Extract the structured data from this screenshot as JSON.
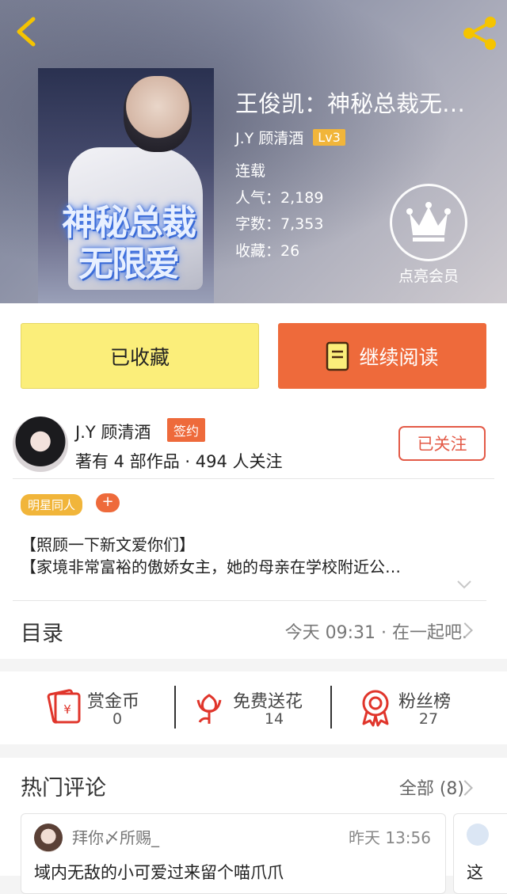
{
  "header": {
    "book_title": "王俊凯：神秘总裁无…",
    "author": "J.Y 顾清酒",
    "level": "Lv3",
    "status": "连载",
    "popularity_label": "人气：",
    "popularity": "2,189",
    "words_label": "字数：",
    "words": "7,353",
    "collect_label": "收藏：",
    "collect": "26",
    "vip_label": "点亮会员",
    "cover_title": "神秘总裁无限爱"
  },
  "actions": {
    "favorited_label": "已收藏",
    "continue_label": "继续阅读"
  },
  "author_card": {
    "name": "J.Y 顾清酒",
    "signed_badge": "签约",
    "stats": "著有 4 部作品 · 494 人关注",
    "follow_label": "已关注",
    "tag": "明星同人",
    "tag_add": "+",
    "intro_line1": "【照顾一下新文爱你们】",
    "intro_line2": "【家境非常富裕的傲娇女主，她的母亲在学校附近公…"
  },
  "toc": {
    "label": "目录",
    "latest": "今天 09:31 · 在一起吧."
  },
  "stats": [
    {
      "label": "赏金币",
      "value": "0",
      "icon": "red-envelope-icon"
    },
    {
      "label": "免费送花",
      "value": "14",
      "icon": "flower-icon"
    },
    {
      "label": "粉丝榜",
      "value": "27",
      "icon": "medal-icon"
    }
  ],
  "comments": {
    "title": "热门评论",
    "all_label": "全部 (8)",
    "items": [
      {
        "user": "拜你〆所赐_",
        "time": "昨天 13:56",
        "text": "域内无敌的小可爱过来留个喵爪爪"
      },
      {
        "user": "",
        "time": "",
        "text": "这"
      }
    ]
  },
  "colors": {
    "accent_orange": "#ee6a3b",
    "favorite_yellow": "#fbee7a",
    "level_badge": "#f1b53a",
    "follow_red": "#e35a47"
  }
}
